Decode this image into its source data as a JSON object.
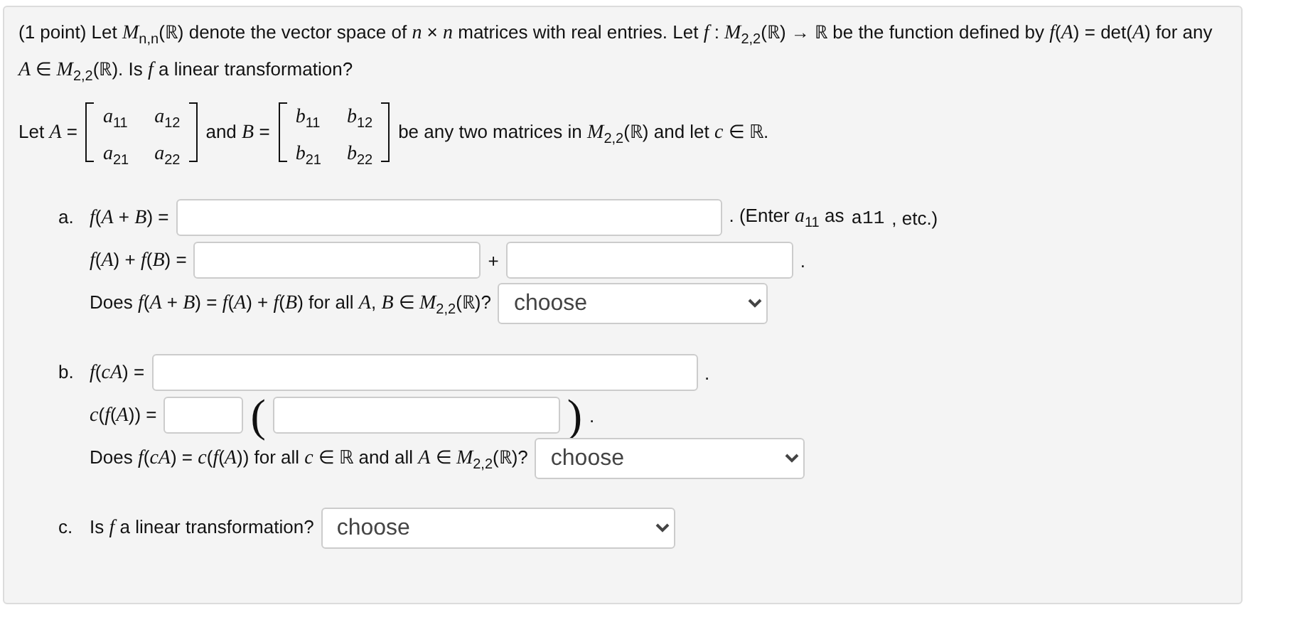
{
  "intro": "(1 point) Let *M*$_{n,n}$(ℝ) denote the vector space of *n* × *n* matrices with real entries. Let *f* : *M*$_{2,2}$(ℝ) → ℝ be the function defined by *f*(*A*) = det(*A*) for any *A* ∈ *M*$_{2,2}$(ℝ). Is *f* a linear transformation?",
  "let_line": [
    {
      "kind": "text",
      "text": "Let *A* ="
    },
    {
      "kind": "matrix",
      "entries": [
        [
          "*a*$_{11}$",
          "*a*$_{12}$"
        ],
        [
          "*a*$_{21}$",
          "*a*$_{22}$"
        ]
      ]
    },
    {
      "kind": "text",
      "text": "and *B* ="
    },
    {
      "kind": "matrix",
      "entries": [
        [
          "*b*$_{11}$",
          "*b*$_{12}$"
        ],
        [
          "*b*$_{21}$",
          "*b*$_{22}$"
        ]
      ]
    },
    {
      "kind": "text",
      "text": "be any two matrices in *M*$_{2,2}$(ℝ) and let *c* ∈ ℝ."
    }
  ],
  "parts": [
    {
      "label": "a.",
      "rows": [
        {
          "items": [
            {
              "kind": "text",
              "text": "*f*(*A* + *B*) ="
            },
            {
              "kind": "longfield"
            },
            {
              "kind": "note",
              "text": ". (Enter *a*$_{11}$ as"
            },
            {
              "kind": "code",
              "text": "a11"
            },
            {
              "kind": "note",
              "text": ", etc.)"
            }
          ]
        },
        {
          "items": [
            {
              "kind": "text",
              "text": "*f*(*A*) + *f*(*B*) ="
            },
            {
              "kind": "field"
            },
            {
              "kind": "text",
              "text": "+"
            },
            {
              "kind": "field"
            },
            {
              "kind": "text",
              "text": "."
            }
          ]
        },
        {
          "items": [
            {
              "kind": "text",
              "text": "Does *f*(*A* + *B*) = *f*(*A*) + *f*(*B*) for all *A*, *B* ∈ *M*$_{2,2}$(ℝ)?"
            },
            {
              "kind": "select",
              "value": "choose"
            }
          ]
        }
      ]
    },
    {
      "label": "b.",
      "rows": [
        {
          "items": [
            {
              "kind": "text",
              "text": "*f*(*cA*) ="
            },
            {
              "kind": "longfield"
            },
            {
              "kind": "text",
              "text": "."
            }
          ]
        },
        {
          "items": [
            {
              "kind": "text",
              "text": "*c*(*f*(*A*)) ="
            },
            {
              "kind": "shortfield"
            },
            {
              "kind": "paren",
              "text": "("
            },
            {
              "kind": "field"
            },
            {
              "kind": "paren",
              "text": ")"
            },
            {
              "kind": "text",
              "text": "."
            }
          ]
        },
        {
          "items": [
            {
              "kind": "text",
              "text": "Does *f*(*cA*) = *c*(*f*(*A*)) for all *c* ∈ ℝ and all *A* ∈ *M*$_{2,2}$(ℝ)?"
            },
            {
              "kind": "select",
              "value": "choose"
            }
          ]
        }
      ]
    },
    {
      "label": "c.",
      "rows": [
        {
          "items": [
            {
              "kind": "text",
              "text": "Is *f* a linear transformation?"
            },
            {
              "kind": "longselect",
              "value": "choose"
            }
          ]
        }
      ]
    }
  ]
}
